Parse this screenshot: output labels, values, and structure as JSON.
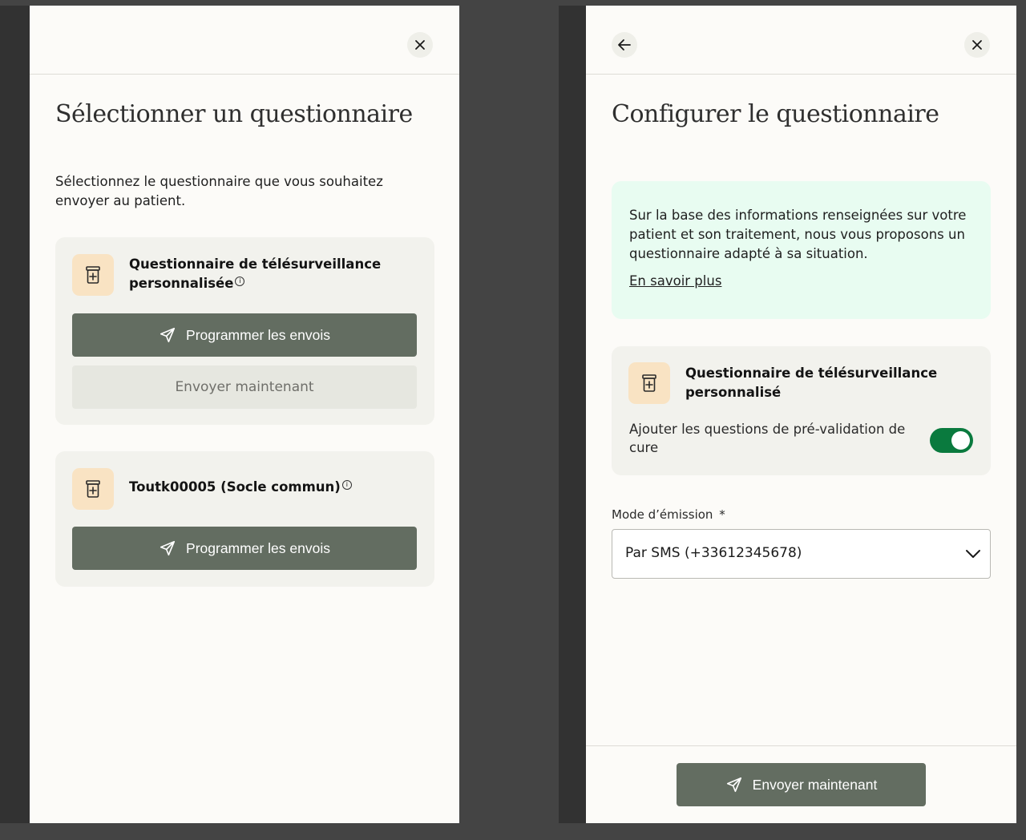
{
  "left_panel": {
    "close_icon": "close-icon",
    "title": "Sélectionner un questionnaire",
    "intro": "Sélectionnez le questionnaire que vous souhaitez envoyer au patient.",
    "cards": [
      {
        "icon": "questionnaire-jar-icon",
        "name": "Questionnaire de télésurveillance personnalisée",
        "info_glyph": "i",
        "primary_button": "Programmer les envois",
        "secondary_button": "Envoyer maintenant"
      },
      {
        "icon": "questionnaire-jar-icon",
        "name": "Toutk00005 (Socle commun)",
        "info_glyph": "i",
        "primary_button": "Programmer les envois"
      }
    ]
  },
  "right_panel": {
    "back_icon": "arrow-left-icon",
    "close_icon": "close-icon",
    "title": "Configurer le questionnaire",
    "info_box": {
      "text": "Sur la base des informations renseignées sur votre patient et son traitement, nous vous proposons un questionnaire adapté à sa situation.",
      "link": "En savoir plus"
    },
    "card": {
      "icon": "questionnaire-jar-icon",
      "name": "Questionnaire de télésurveillance personnalisé",
      "toggle_label": "Ajouter les questions de pré-validation de cure",
      "toggle_on": true
    },
    "mode": {
      "label": "Mode d’émission",
      "required_mark": "*",
      "value": "Par SMS (+33612345678)"
    },
    "send_button": "Envoyer maintenant"
  },
  "colors": {
    "primary_button": "#636d61",
    "toggle_on": "#0a7a3e",
    "info_box_bg": "#e8fcf1",
    "icon_bg": "#f9e3c3",
    "card_bg": "#f2f2ed"
  }
}
